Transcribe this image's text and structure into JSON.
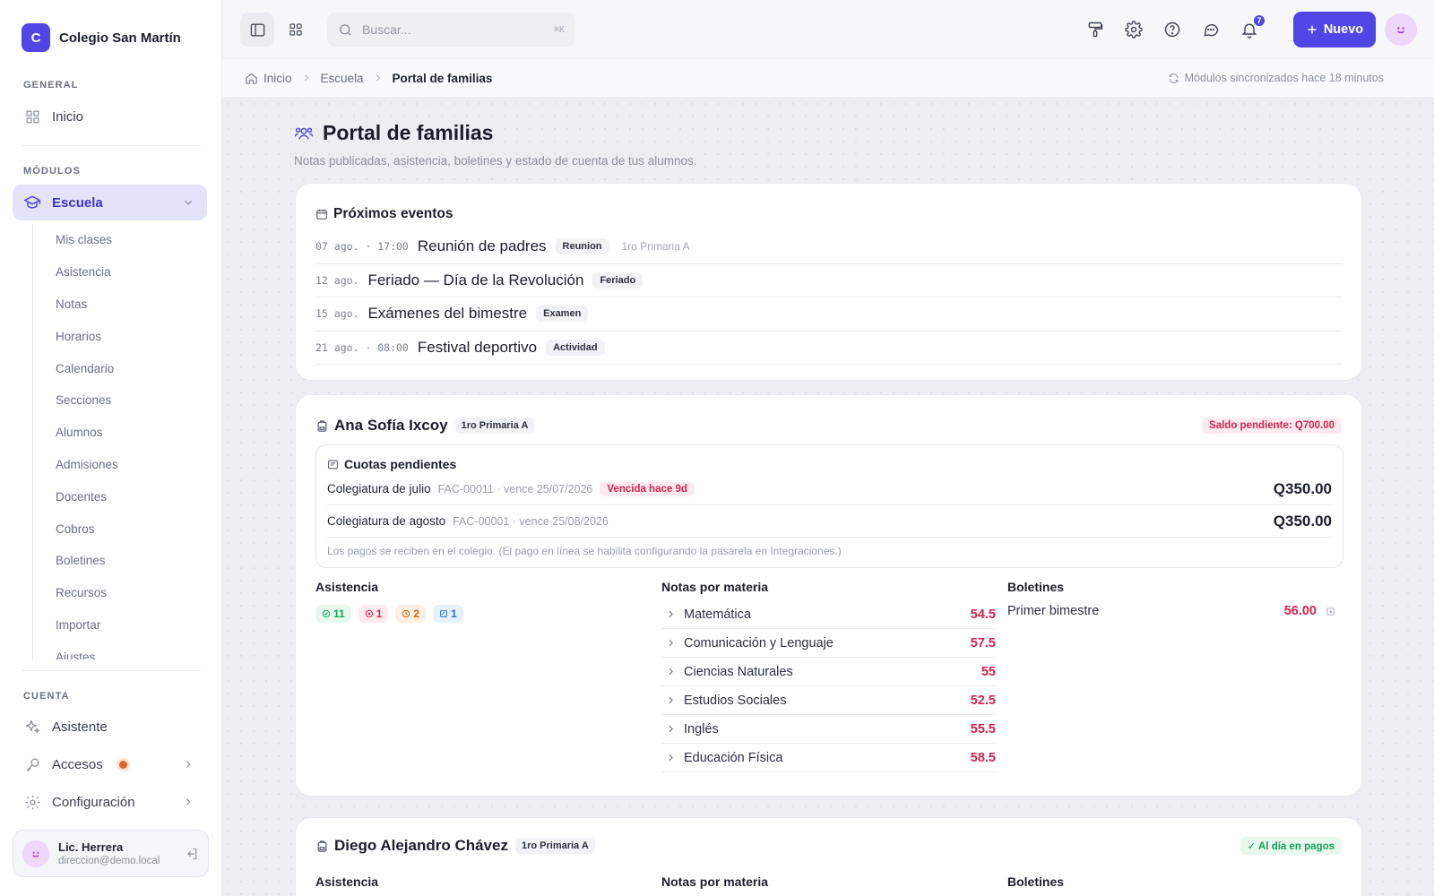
{
  "brand": {
    "logo_letter": "C",
    "name": "Colegio San Martín"
  },
  "sidebar": {
    "general_label": "GENERAL",
    "home_label": "Inicio",
    "modules_label": "MÓDULOS",
    "escuela_label": "Escuela",
    "submenu": [
      "Mis clases",
      "Asistencia",
      "Notas",
      "Horarios",
      "Calendario",
      "Secciones",
      "Alumnos",
      "Admisiones",
      "Docentes",
      "Cobros",
      "Boletines",
      "Recursos",
      "Importar",
      "Ajustes"
    ],
    "account_label": "CUENTA",
    "assistant_label": "Asistente",
    "access_label": "Accesos",
    "config_label": "Configuración",
    "user": {
      "name": "Lic. Herrera",
      "email": "direccion@demo.local"
    }
  },
  "topbar": {
    "search_placeholder": "Buscar...",
    "search_shortcut": "⌘K",
    "notification_count": "7",
    "new_label": "Nuevo"
  },
  "breadcrumb": {
    "home": "Inicio",
    "section": "Escuela",
    "current": "Portal de familias",
    "sync": "Módulos sincronizados hace 18 minutos"
  },
  "page": {
    "title": "Portal de familias",
    "subtitle": "Notas publicadas, asistencia, boletines y estado de cuenta de tus alumnos."
  },
  "events": {
    "title": "Próximos eventos",
    "items": [
      {
        "date": "07 ago. · 17:00",
        "title": "Reunión de padres",
        "tag": "Reunion",
        "section": "1ro Primaria A"
      },
      {
        "date": "12 ago.",
        "title": "Feriado — Día de la Revolución",
        "tag": "Feriado",
        "section": ""
      },
      {
        "date": "15 ago.",
        "title": "Exámenes del bimestre",
        "tag": "Examen",
        "section": ""
      },
      {
        "date": "21 ago. · 08:00",
        "title": "Festival deportivo",
        "tag": "Actividad",
        "section": ""
      }
    ]
  },
  "students": [
    {
      "name": "Ana Sofía Ixcoy",
      "grade": "1ro Primaria A",
      "balance": "Saldo pendiente: Q700.00",
      "fees_title": "Cuotas pendientes",
      "fees": [
        {
          "name": "Colegiatura de julio",
          "meta": "FAC-00011 · vence 25/07/2026",
          "late": "Vencida hace 9d",
          "amount": "Q350.00"
        },
        {
          "name": "Colegiatura de agosto",
          "meta": "FAC-00001 · vence 25/08/2026",
          "late": "",
          "amount": "Q350.00"
        }
      ],
      "fees_note": "Los pagos se reciben en el colegio. (El pago en línea se habilita configurando la pasarela en Integraciones.)",
      "attendance_title": "Asistencia",
      "attendance": {
        "present": "11",
        "absent": "1",
        "late": "2",
        "excused": "1"
      },
      "grades_title": "Notas por materia",
      "subjects": [
        {
          "name": "Matemática",
          "score": "54.5"
        },
        {
          "name": "Comunicación y Lenguaje",
          "score": "57.5"
        },
        {
          "name": "Ciencias Naturales",
          "score": "55"
        },
        {
          "name": "Estudios Sociales",
          "score": "52.5"
        },
        {
          "name": "Inglés",
          "score": "55.5"
        },
        {
          "name": "Educación Física",
          "score": "58.5"
        }
      ],
      "reports_title": "Boletines",
      "reports": [
        {
          "name": "Primer bimestre",
          "score": "56.00"
        }
      ]
    },
    {
      "name": "Diego Alejandro Chávez",
      "grade": "1ro Primaria A",
      "status": "✓ Al día en pagos",
      "attendance_title": "Asistencia",
      "grades_title": "Notas por materia",
      "reports_title": "Boletines"
    }
  ],
  "colors": {
    "accent": "#4f46e5",
    "danger": "#d1244d",
    "success": "#16a35a"
  }
}
